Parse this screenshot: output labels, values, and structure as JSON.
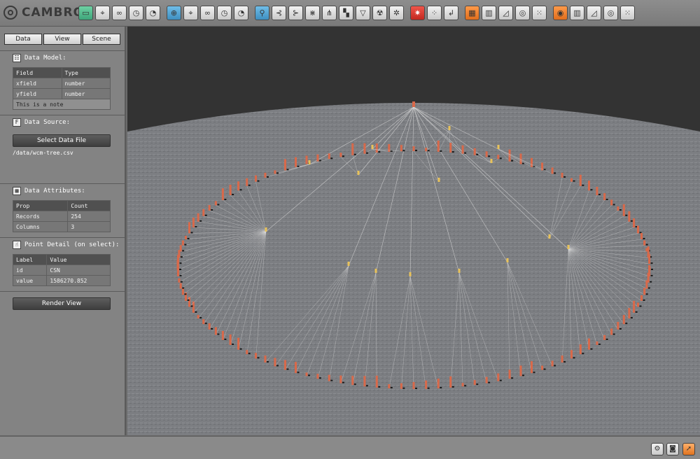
{
  "app": {
    "name": "CAMBRO"
  },
  "toolbar": {
    "groups": [
      {
        "color": "green",
        "icons": [
          "table-icon",
          "map-pin-icon",
          "link-icon",
          "clock-icon",
          "pie-icon"
        ]
      },
      {
        "color": "blue",
        "icons": [
          "globe-icon",
          "map-pin-icon",
          "link-icon",
          "clock-icon",
          "pie-icon"
        ]
      },
      {
        "color": "blue",
        "icons": [
          "tree-icon",
          "tree-right-icon",
          "tree-left-icon",
          "network-icon",
          "share-icon",
          "grid-squares-icon",
          "funnel-icon",
          "radiation-icon",
          "gear-cog-icon"
        ]
      },
      {
        "color": "red",
        "icons": [
          "cluster-icon",
          "scatter-icon",
          "path-icon"
        ]
      },
      {
        "color": "orange",
        "icons": [
          "heatgrid-icon",
          "bar-chart-icon",
          "area-chart-icon",
          "radial-icon",
          "bubble-icon"
        ]
      },
      {
        "color": "orange",
        "icons": [
          "target-icon",
          "bar-chart-icon",
          "area-chart-icon",
          "radial-icon",
          "bubble-icon"
        ]
      }
    ]
  },
  "tabs": [
    "Data",
    "View",
    "Scene"
  ],
  "data_model": {
    "title": "Data Model:",
    "headers": [
      "Field",
      "Type"
    ],
    "rows": [
      [
        "xfield",
        "number"
      ],
      [
        "yfield",
        "number"
      ]
    ],
    "note": "This is a note"
  },
  "data_source": {
    "title": "Data Source:",
    "button": "Select Data File",
    "path": "/data/wcm-tree.csv"
  },
  "data_attributes": {
    "title": "Data Attributes:",
    "headers": [
      "Prop",
      "Count"
    ],
    "rows": [
      [
        "Records",
        "254"
      ],
      [
        "Columns",
        "3"
      ]
    ]
  },
  "point_detail": {
    "title": "Point Detail (on select):",
    "headers": [
      "Label",
      "Value"
    ],
    "rows": [
      [
        "id",
        "CSN"
      ],
      [
        "value",
        "1586270.852"
      ]
    ]
  },
  "render_button": "Render View",
  "status_icons": [
    "settings-icon",
    "camera-icon",
    "export-icon"
  ],
  "scene_colors": {
    "bars": "#d9694a",
    "nodes": "#e8c25a",
    "edges": "#d8d8d8",
    "ground": "#7a7c80"
  }
}
